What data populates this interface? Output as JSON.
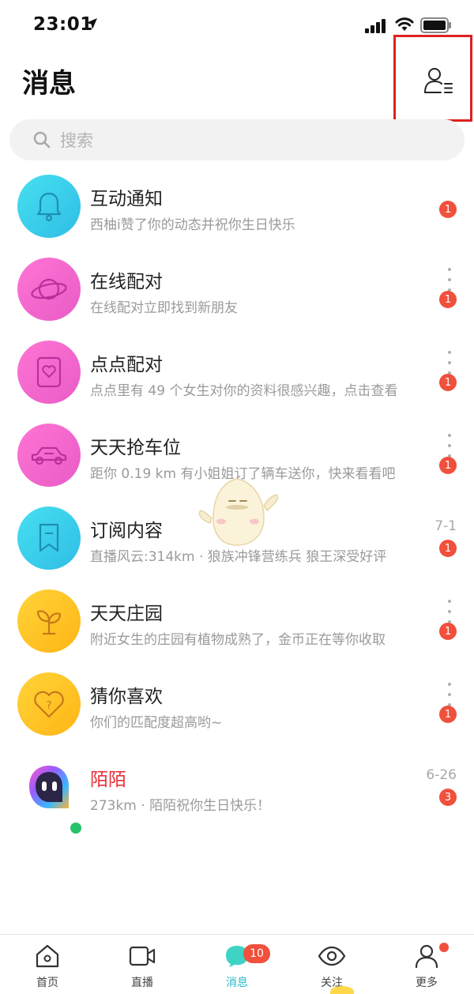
{
  "status_bar": {
    "time": "23:01"
  },
  "header": {
    "title": "消息"
  },
  "search": {
    "placeholder": "搜索"
  },
  "messages": [
    {
      "title": "互动通知",
      "preview": "西柚i赞了你的动态并祝你生日快乐",
      "badge": "1",
      "icon": "bell-icon",
      "color": "#3dcde6"
    },
    {
      "title": "在线配对",
      "preview": "在线配对立即找到新朋友",
      "badge": "1",
      "icon": "planet-icon",
      "color": "#f264c8"
    },
    {
      "title": "点点配对",
      "preview": "点点里有 49 个女生对你的资料很感兴趣，点击查看",
      "badge": "1",
      "icon": "heart-card-icon",
      "color": "#f264c8"
    },
    {
      "title": "天天抢车位",
      "preview": "距你 0.19 km 有小姐姐订了辆车送你，快来看看吧",
      "badge": "1",
      "icon": "car-icon",
      "color": "#f264c8"
    },
    {
      "title": "订阅内容",
      "preview": "直播风云:314km · 狼族冲锋营练兵 狼王深受好评",
      "badge": "1",
      "time": "7-1",
      "icon": "bookmark-icon",
      "color": "#3dcde6"
    },
    {
      "title": "天天庄园",
      "preview": "附近女生的庄园有植物成熟了，金币正在等你收取",
      "badge": "1",
      "icon": "sprout-icon",
      "color": "#ffc21a"
    },
    {
      "title": "猜你喜欢",
      "preview": "你们的匹配度超高哟~",
      "badge": "1",
      "icon": "heart-question-icon",
      "color": "#ffc21a"
    },
    {
      "title": "陌陌",
      "preview": "273km · 陌陌祝你生日快乐！",
      "badge": "3",
      "time": "6-26",
      "icon": "momo-logo-icon"
    }
  ],
  "tabs": [
    {
      "label": "首页",
      "icon": "home-icon"
    },
    {
      "label": "直播",
      "icon": "video-icon"
    },
    {
      "label": "消息",
      "icon": "chat-icon",
      "badge": "10",
      "active": true
    },
    {
      "label": "关注",
      "icon": "eye-icon"
    },
    {
      "label": "更多",
      "icon": "profile-icon"
    }
  ],
  "colors": {
    "accent": "#26b9c6",
    "badge": "#f0503c",
    "online": "#27c36a"
  }
}
